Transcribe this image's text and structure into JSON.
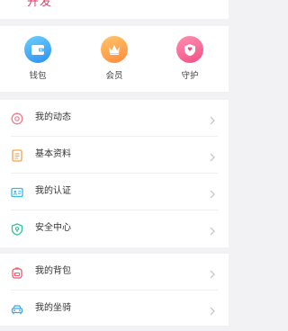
{
  "header": {
    "partial_text": "开发"
  },
  "quick": [
    {
      "label": "钱包",
      "icon": "wallet-icon",
      "color_from": "#6ad0ff",
      "color_to": "#2d8ff0"
    },
    {
      "label": "会员",
      "icon": "crown-icon",
      "color_from": "#ffc46a",
      "color_to": "#ff8a3c"
    },
    {
      "label": "守护",
      "icon": "shield-icon",
      "color_from": "#ff8fb0",
      "color_to": "#f24f86"
    }
  ],
  "menu_group_1": [
    {
      "label": "我的动态",
      "icon": "moments-icon",
      "color": "#f07a8c"
    },
    {
      "label": "基本资料",
      "icon": "profile-icon",
      "color": "#f6a24a"
    },
    {
      "label": "我的认证",
      "icon": "id-card-icon",
      "color": "#3ab7e8"
    },
    {
      "label": "安全中心",
      "icon": "shield-check-icon",
      "color": "#2cc49a"
    }
  ],
  "menu_group_2": [
    {
      "label": "我的背包",
      "icon": "backpack-icon",
      "color": "#f05a6e"
    },
    {
      "label": "我的坐骑",
      "icon": "car-icon",
      "color": "#3aa8e8"
    }
  ]
}
